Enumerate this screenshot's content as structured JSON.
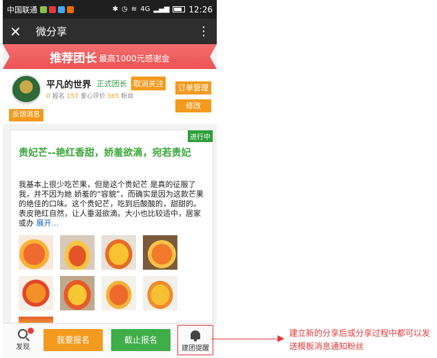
{
  "status_bar": {
    "carrier": "中国联通",
    "signal": "4G",
    "time": "12:26"
  },
  "title_bar": {
    "title": "微分享"
  },
  "banner": {
    "headline": "推荐团长",
    "subline": "最高1000元感谢金"
  },
  "profile": {
    "name": "平凡的世界",
    "role": "正式团长",
    "unfollow_label": "取消关注",
    "stats": {
      "signups": "0",
      "signups_label": "报名",
      "reviews": "157",
      "reviews_label": "爱心评价",
      "fans": "565",
      "fans_label": "粉丝"
    },
    "orders_label": "订单管理",
    "edit_label": "修改",
    "feedback_label": "反馈消息"
  },
  "post": {
    "status_tag": "进行中",
    "title": "贵妃芒--艳红香甜，娇羞欲滴，宛若贵妃",
    "body": "我基本上很少吃芒果，但是这个贵妃芒 是真的征服了我，并不因为她 娇羞的“容貌”，而确实是因为这款芒果的绝佳的口味。这个贵妃芒，吃到后酸酸的，甜甜的。表皮艳红自然，让人垂涎欲滴。大小也比较适中，居家或办",
    "expand_label": "展开..."
  },
  "bottom_bar": {
    "discover_label": "发现",
    "signup_label": "我要报名",
    "stop_label": "截止报名",
    "remind_label": "建团提醒"
  },
  "annotation": {
    "text": "建立新的分享后或分享过程中都可以发送模板消息通知粉丝"
  },
  "colors": {
    "accent_orange": "#f39a1f",
    "accent_green": "#3fae48",
    "banner_red": "#ec5454",
    "annotation_red": "#e23a3a"
  }
}
